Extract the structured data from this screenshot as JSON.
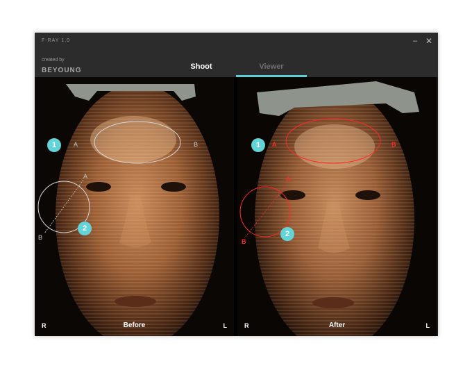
{
  "window": {
    "title": "F-RAY 1.0",
    "minimize_glyph": "–",
    "close_glyph": "✕"
  },
  "brand": {
    "prefix": "created by",
    "name": "BEYOUNG"
  },
  "tabs": [
    {
      "label": "Shoot",
      "active": true
    },
    {
      "label": "Viewer",
      "active": false,
      "underline": true
    }
  ],
  "colors": {
    "accent": "#5ccfd6",
    "badge": "#62d4d8",
    "marker_before": "#cfcfcf",
    "marker_after": "#ff2a2a"
  },
  "panels": {
    "before": {
      "caption": "Before",
      "side_right": "R",
      "side_left": "L",
      "points": {
        "a1": "A",
        "b1": "B",
        "a2": "A",
        "b2": "B"
      },
      "badges": [
        "1",
        "2"
      ]
    },
    "after": {
      "caption": "After",
      "side_right": "R",
      "side_left": "L",
      "points": {
        "a1": "A",
        "b1": "B",
        "a2": "A",
        "b2": "B"
      },
      "badges": [
        "1",
        "2"
      ]
    }
  }
}
